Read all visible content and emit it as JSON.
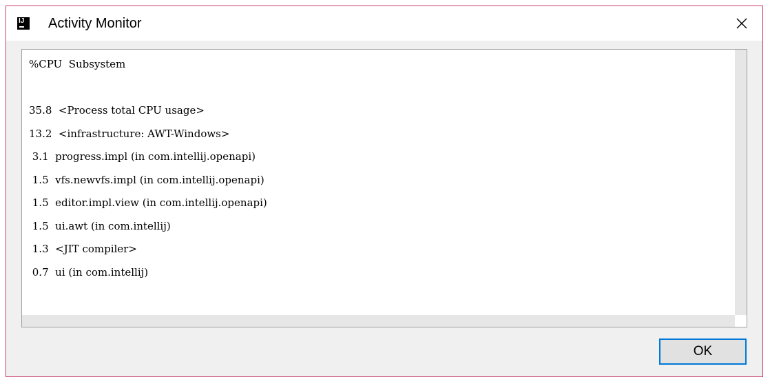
{
  "window": {
    "title": "Activity Monitor",
    "app_icon_text": "IJ"
  },
  "monitor": {
    "lines": [
      "%CPU  Subsystem",
      "",
      "35.8  <Process total CPU usage>",
      "13.2  <infrastructure: AWT-Windows>",
      " 3.1  progress.impl (in com.intellij.openapi)",
      " 1.5  vfs.newvfs.impl (in com.intellij.openapi)",
      " 1.5  editor.impl.view (in com.intellij.openapi)",
      " 1.5  ui.awt (in com.intellij)",
      " 1.3  <JIT compiler>",
      " 0.7  ui (in com.intellij)"
    ]
  },
  "buttons": {
    "ok_label": "OK"
  },
  "icons": {
    "app": "intellij-app-icon",
    "close": "close-icon"
  },
  "colors": {
    "window_border": "#c7386a",
    "ok_border": "#0078d7"
  }
}
